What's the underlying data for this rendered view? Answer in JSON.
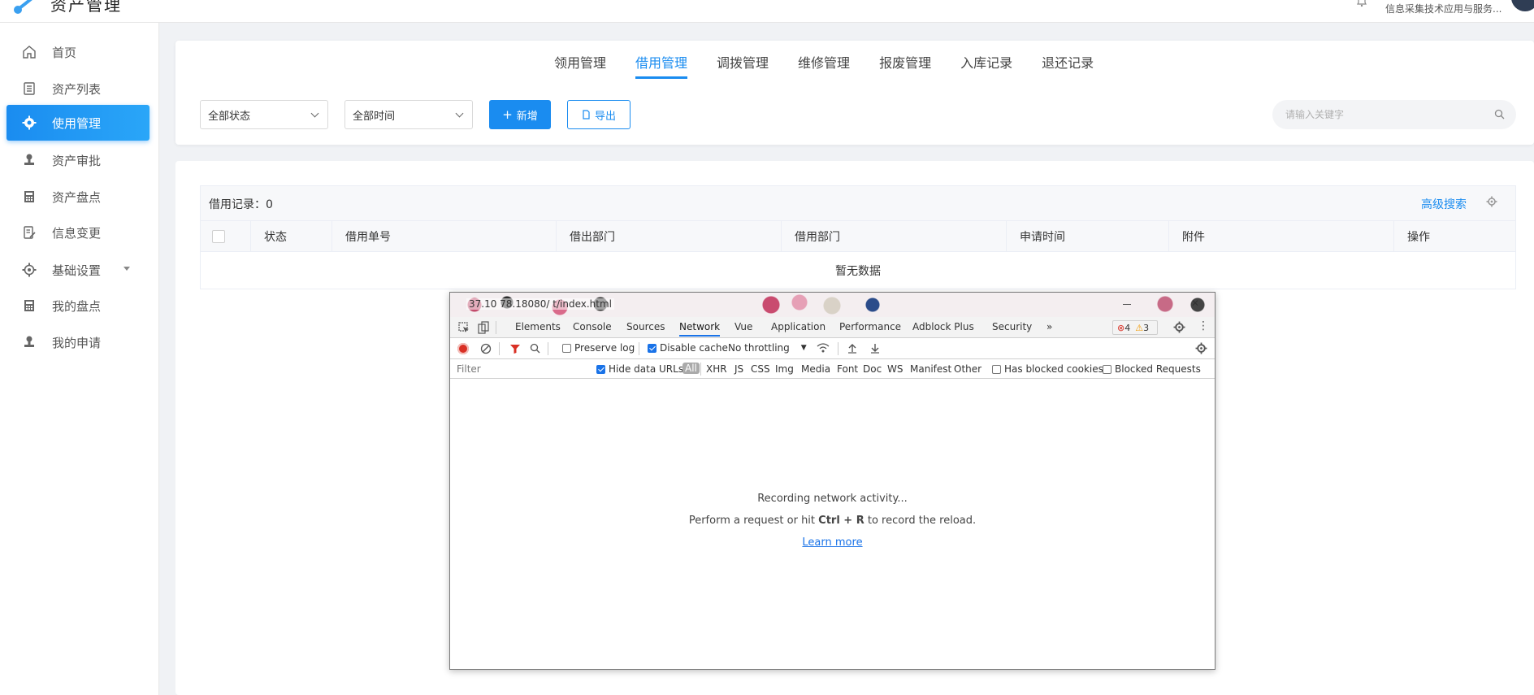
{
  "app": {
    "title": "资产管理",
    "user_name": "信息采集技术应用与服务..."
  },
  "sidebar": {
    "items": [
      {
        "label": "首页",
        "icon": "home-icon"
      },
      {
        "label": "资产列表",
        "icon": "list-icon"
      },
      {
        "label": "使用管理",
        "icon": "gear-icon",
        "active": true
      },
      {
        "label": "资产审批",
        "icon": "stamp-icon"
      },
      {
        "label": "资产盘点",
        "icon": "calculator-icon"
      },
      {
        "label": "信息变更",
        "icon": "edit-icon"
      },
      {
        "label": "基础设置",
        "icon": "settings-icon",
        "has_submenu": true
      },
      {
        "label": "我的盘点",
        "icon": "calculator-icon"
      },
      {
        "label": "我的申请",
        "icon": "stamp-icon"
      }
    ]
  },
  "tabs": [
    "领用管理",
    "借用管理",
    "调拨管理",
    "维修管理",
    "报废管理",
    "入库记录",
    "退还记录"
  ],
  "active_tab": "借用管理",
  "filters": {
    "status_select": "全部状态",
    "time_select": "全部时间",
    "add_button": "新增",
    "export_button": "导出",
    "search_placeholder": "请输入关键字"
  },
  "table": {
    "record_label": "借用记录：",
    "record_count": "0",
    "advanced_search": "高级搜索",
    "columns": [
      "状态",
      "借用单号",
      "借出部门",
      "借用部门",
      "申请时间",
      "附件",
      "操作"
    ],
    "empty_text": "暂无数据"
  },
  "devtools": {
    "url_fragment": "37.10  78.18080/     t/index.html",
    "tabs": [
      "Elements",
      "Console",
      "Sources",
      "Network",
      "Vue",
      "Application",
      "Performance",
      "Adblock Plus",
      "Security",
      "»"
    ],
    "active_tab": "Network",
    "errors": "4",
    "warnings": "3",
    "toolbar": {
      "preserve_log": "Preserve log",
      "disable_cache": "Disable cache",
      "throttling": "No throttling"
    },
    "filter": {
      "placeholder": "Filter",
      "hide_data_urls": "Hide data URLs",
      "types": [
        "All",
        "XHR",
        "JS",
        "CSS",
        "Img",
        "Media",
        "Font",
        "Doc",
        "WS",
        "Manifest",
        "Other"
      ],
      "has_blocked_cookies": "Has blocked cookies",
      "blocked_requests": "Blocked Requests"
    },
    "messages": {
      "recording": "Recording network activity...",
      "hint_prefix": "Perform a request or hit ",
      "hint_keys": "Ctrl + R",
      "hint_suffix": " to record the reload.",
      "learn_more": "Learn more"
    }
  },
  "colors": {
    "accent": "#1a8cf0",
    "devtools_accent": "#1a73e8"
  }
}
